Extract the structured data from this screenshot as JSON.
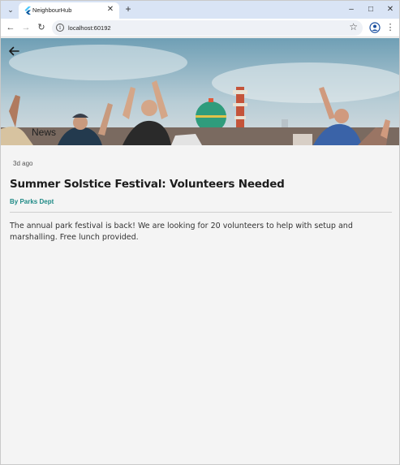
{
  "browser": {
    "tab_title": "NeighbourHub",
    "new_tab_label": "+",
    "url": "localhost:60192"
  },
  "colors": {
    "tabstrip": "#d9e4f5",
    "author_accent": "#1f8a86",
    "page_background": "#f4f4f4"
  },
  "icons": {
    "tab_menu": "chevron-down-icon",
    "favicon": "flutter-icon",
    "tab_close": "close-icon",
    "back": "arrow-left-icon",
    "forward": "arrow-right-icon",
    "reload": "reload-icon",
    "site_info": "info-icon",
    "bookmark": "star-icon",
    "profile": "profile-icon",
    "menu": "kebab-icon",
    "app_back": "arrow-left-icon"
  },
  "app": {
    "section_label": "News",
    "article": {
      "timestamp": "3d ago",
      "title": "Summer Solstice Festival: Volunteers Needed",
      "author": "By Parks Dept",
      "body": "The annual park festival is back! We are looking for 20 volunteers to help with setup and marshalling. Free lunch provided."
    }
  }
}
